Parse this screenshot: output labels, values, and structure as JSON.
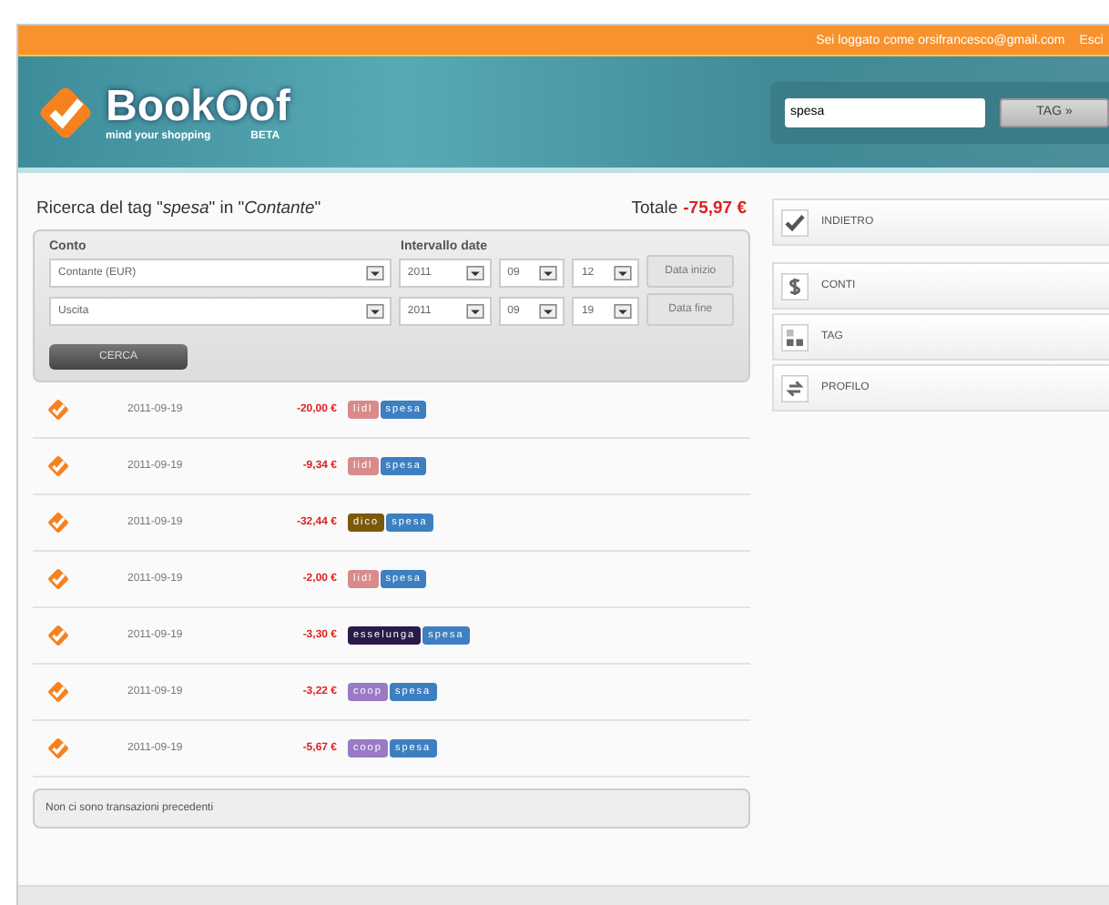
{
  "topbar": {
    "login_text": "Sei loggato come orsifrancesco@gmail.com",
    "logout_link": "Esci"
  },
  "header": {
    "logo_name": "BookOof",
    "tagline": "mind your shopping",
    "badge": "BETA",
    "search": {
      "value": "spesa"
    },
    "tag_button": "TAG »"
  },
  "search_panel": {
    "title": "Ricerca del tag \"*spesa*\" in \"*Contante*\"",
    "total_label": "Totale",
    "total_value": "-75,97 €",
    "account_label": "Conto",
    "date_label": "Intervallo date",
    "rows": [
      {
        "select": "Contante (EUR)",
        "year": "2011",
        "month": "09",
        "day": "12",
        "button": "Data inizio"
      },
      {
        "select": "Uscita",
        "year": "2011",
        "month": "09",
        "day": "19",
        "button": "Data fine"
      }
    ],
    "search_button": "CERCA"
  },
  "transactions": [
    {
      "date": "2011-09-19",
      "amount": "-20,00 €",
      "tags": [
        {
          "label": "lidl",
          "color": "#d98b8b"
        },
        {
          "label": "spesa",
          "color": "#3d7fc1"
        }
      ]
    },
    {
      "date": "2011-09-19",
      "amount": "-9,34 €",
      "tags": [
        {
          "label": "lidl",
          "color": "#d98b8b"
        },
        {
          "label": "spesa",
          "color": "#3d7fc1"
        }
      ]
    },
    {
      "date": "2011-09-19",
      "amount": "-32,44 €",
      "tags": [
        {
          "label": "dico",
          "color": "#7a5a0a"
        },
        {
          "label": "spesa",
          "color": "#3d7fc1"
        }
      ]
    },
    {
      "date": "2011-09-19",
      "amount": "-2,00 €",
      "tags": [
        {
          "label": "lidl",
          "color": "#d98b8b"
        },
        {
          "label": "spesa",
          "color": "#3d7fc1"
        }
      ]
    },
    {
      "date": "2011-09-19",
      "amount": "-3,30 €",
      "tags": [
        {
          "label": "esselunga",
          "color": "#2a1a4a"
        },
        {
          "label": "spesa",
          "color": "#3d7fc1"
        }
      ]
    },
    {
      "date": "2011-09-19",
      "amount": "-3,22 €",
      "tags": [
        {
          "label": "coop",
          "color": "#9a7ac4"
        },
        {
          "label": "spesa",
          "color": "#3d7fc1"
        }
      ]
    },
    {
      "date": "2011-09-19",
      "amount": "-5,67 €",
      "tags": [
        {
          "label": "coop",
          "color": "#9a7ac4"
        },
        {
          "label": "spesa",
          "color": "#3d7fc1"
        }
      ]
    }
  ],
  "footer_message": "Non ci sono transazioni precedenti",
  "sidebar": {
    "items": [
      {
        "label": "INDIETRO",
        "kind": "check"
      },
      {
        "label": "CONTI",
        "kind": "dollar"
      },
      {
        "label": "TAG",
        "kind": "blocks"
      },
      {
        "label": "PROFILO",
        "kind": "swap"
      }
    ]
  }
}
